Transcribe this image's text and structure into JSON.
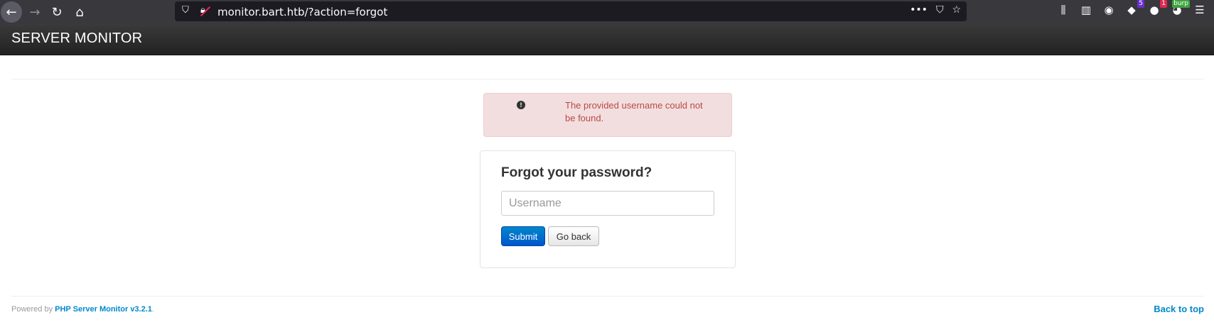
{
  "browser": {
    "url": "monitor.bart.htb/?action=forgot",
    "url_actions": [
      "•••",
      "⛉",
      "☆"
    ],
    "extensions": [
      {
        "name": "library-icon",
        "glyph": "⫼"
      },
      {
        "name": "sidebar-icon",
        "glyph": "▥"
      },
      {
        "name": "account-icon",
        "glyph": "◉"
      },
      {
        "name": "extension-purple-icon",
        "glyph": "◆",
        "badge": "5",
        "badge_color": "#6b2fd1"
      },
      {
        "name": "extension-cookie-icon",
        "glyph": "●",
        "badge": "1",
        "badge_color": "#e22850"
      },
      {
        "name": "burp-icon",
        "glyph": "◕",
        "badge": "burp",
        "badge_color": "#3fa33f"
      },
      {
        "name": "menu-icon",
        "glyph": "☰"
      }
    ]
  },
  "app": {
    "brand": "SERVER MONITOR"
  },
  "alert": {
    "icon": "!",
    "message": "The provided username could not be found."
  },
  "form": {
    "title": "Forgot your password?",
    "username_placeholder": "Username",
    "username_value": "",
    "submit_label": "Submit",
    "back_label": "Go back"
  },
  "footer": {
    "powered_by": "Powered by ",
    "link_text": "PHP Server Monitor v3.2.1",
    "suffix": ".",
    "back_to_top": "Back to top"
  },
  "colors": {
    "alert_text": "#b94a48",
    "alert_bg": "#f2dede",
    "link": "#0088cc",
    "primary_button": "#0088cc"
  }
}
